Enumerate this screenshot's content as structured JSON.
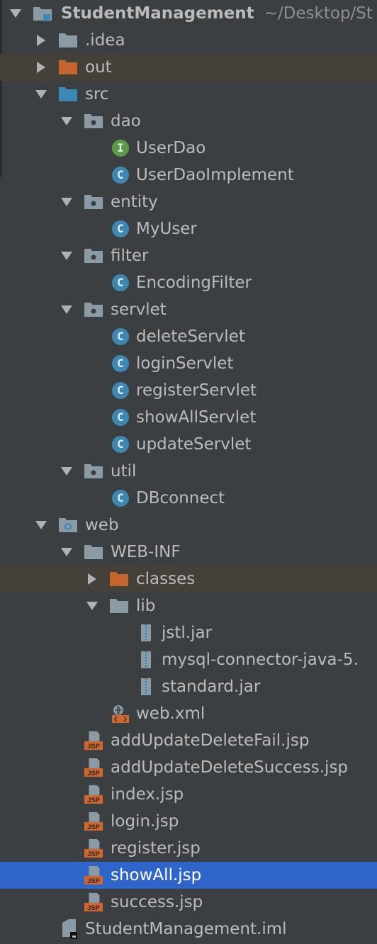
{
  "project_tree": {
    "root": {
      "label": "StudentManagement",
      "path": "~/Desktop/St"
    },
    "items": [
      {
        "label": ".idea"
      },
      {
        "label": "out"
      },
      {
        "label": "src"
      },
      {
        "label": "dao"
      },
      {
        "label": "UserDao"
      },
      {
        "label": "UserDaoImplement"
      },
      {
        "label": "entity"
      },
      {
        "label": "MyUser"
      },
      {
        "label": "filter"
      },
      {
        "label": "EncodingFilter"
      },
      {
        "label": "servlet"
      },
      {
        "label": "deleteServlet"
      },
      {
        "label": "loginServlet"
      },
      {
        "label": "registerServlet"
      },
      {
        "label": "showAllServlet"
      },
      {
        "label": "updateServlet"
      },
      {
        "label": "util"
      },
      {
        "label": "DBconnect"
      },
      {
        "label": "web"
      },
      {
        "label": "WEB-INF"
      },
      {
        "label": "classes"
      },
      {
        "label": "lib"
      },
      {
        "label": "jstl.jar"
      },
      {
        "label": "mysql-connector-java-5."
      },
      {
        "label": "standard.jar"
      },
      {
        "label": "web.xml"
      },
      {
        "label": "addUpdateDeleteFail.jsp"
      },
      {
        "label": "addUpdateDeleteSuccess.jsp"
      },
      {
        "label": "index.jsp"
      },
      {
        "label": "login.jsp"
      },
      {
        "label": "register.jsp"
      },
      {
        "label": "showAll.jsp"
      },
      {
        "label": "success.jsp"
      },
      {
        "label": "StudentManagement.iml"
      }
    ],
    "badges": {
      "class": "C",
      "interface": "I",
      "jsp": "JSP"
    },
    "colors": {
      "background": "#3c3f41",
      "selection": "#2f65ca",
      "excluded_row": "#45403a",
      "folder": "#8a9ba6",
      "source_folder": "#3d89b5",
      "excluded_folder": "#c4642e",
      "class_badge": "#3e87b3",
      "interface_badge": "#5b9b48",
      "jsp_badge": "#d0662d"
    }
  }
}
